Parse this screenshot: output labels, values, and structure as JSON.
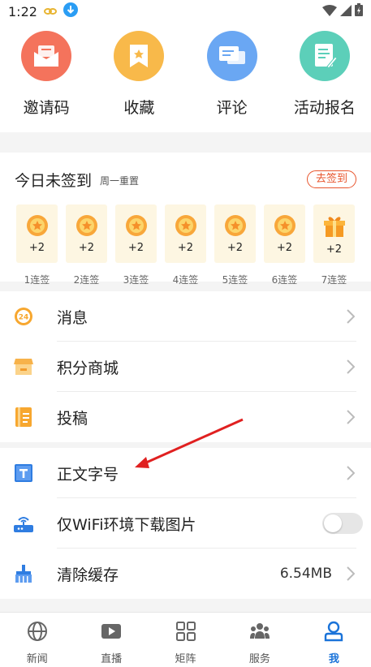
{
  "status_bar": {
    "time": "1:22"
  },
  "quick_actions": [
    {
      "label": "邀请码",
      "icon": "envelope-icon",
      "color": "#f4735c"
    },
    {
      "label": "收藏",
      "icon": "bookmark-icon",
      "color": "#f8b94a"
    },
    {
      "label": "评论",
      "icon": "comment-icon",
      "color": "#6aa7f3"
    },
    {
      "label": "活动报名",
      "icon": "form-icon",
      "color": "#5ccfb9"
    }
  ],
  "signin": {
    "title": "今日未签到",
    "subtitle": "周一重置",
    "button": "去签到",
    "days": [
      {
        "value": "+2",
        "label": "1连签",
        "icon": "coin-icon"
      },
      {
        "value": "+2",
        "label": "2连签",
        "icon": "coin-icon"
      },
      {
        "value": "+2",
        "label": "3连签",
        "icon": "coin-icon"
      },
      {
        "value": "+2",
        "label": "4连签",
        "icon": "coin-icon"
      },
      {
        "value": "+2",
        "label": "5连签",
        "icon": "coin-icon"
      },
      {
        "value": "+2",
        "label": "6连签",
        "icon": "coin-icon"
      },
      {
        "value": "+2",
        "label": "7连签",
        "icon": "gift-icon"
      }
    ]
  },
  "menu_group1": [
    {
      "label": "消息",
      "icon": "message-icon"
    },
    {
      "label": "积分商城",
      "icon": "shop-icon"
    },
    {
      "label": "投稿",
      "icon": "document-icon"
    }
  ],
  "menu_group2": [
    {
      "label": "正文字号",
      "icon": "font-size-icon"
    },
    {
      "label": "仅WiFi环境下载图片",
      "icon": "router-icon",
      "toggle": false
    },
    {
      "label": "清除缓存",
      "icon": "broom-icon",
      "value": "6.54MB"
    }
  ],
  "tabs": [
    {
      "label": "新闻",
      "icon": "globe-icon",
      "active": false
    },
    {
      "label": "直播",
      "icon": "play-icon",
      "active": false
    },
    {
      "label": "矩阵",
      "icon": "grid-icon",
      "active": false
    },
    {
      "label": "服务",
      "icon": "people-icon",
      "active": false
    },
    {
      "label": "我",
      "icon": "person-icon",
      "active": true
    }
  ],
  "colors": {
    "accent": "#1a73d9",
    "signin_button": "#e8552d",
    "annotation_arrow": "#e02020"
  }
}
